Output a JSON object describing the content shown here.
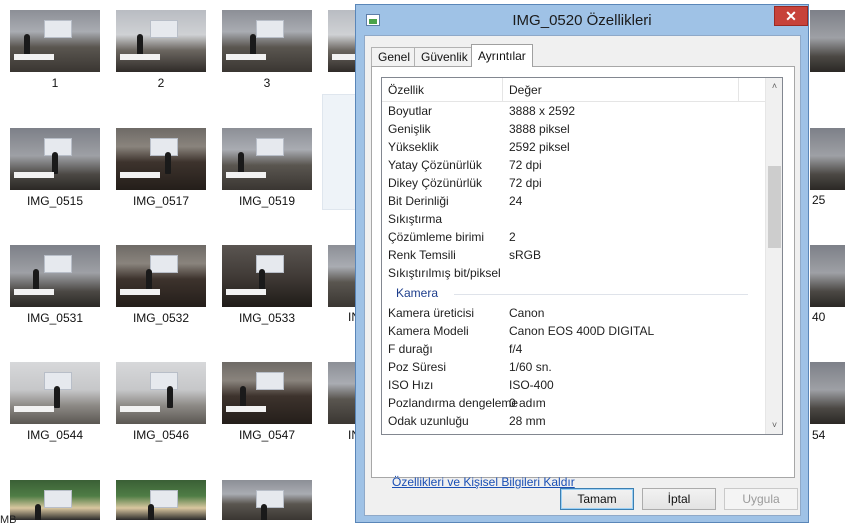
{
  "explorer": {
    "thumbnails": [
      {
        "label": "1",
        "scene": "hall"
      },
      {
        "label": "2",
        "scene": "hall2"
      },
      {
        "label": "3",
        "scene": "hall"
      },
      {
        "label": "",
        "scene": "hall2"
      },
      {
        "label": "IMG_0515",
        "scene": "side"
      },
      {
        "label": "IMG_0517",
        "scene": "crowd"
      },
      {
        "label": "IMG_0519",
        "scene": "hall"
      },
      {
        "label": "IMG_0531",
        "scene": "side"
      },
      {
        "label": "IMG_0532",
        "scene": "crowd"
      },
      {
        "label": "IMG_0533",
        "scene": "dark"
      },
      {
        "label": "IMG_0544",
        "scene": "light"
      },
      {
        "label": "IMG_0546",
        "scene": "light"
      },
      {
        "label": "IMG_0547",
        "scene": "crowd"
      },
      {
        "label": "",
        "scene": "green"
      },
      {
        "label": "",
        "scene": "green"
      },
      {
        "label": "",
        "scene": "hall"
      }
    ],
    "partial_labels": {
      "r2": "IN",
      "r3": "IN",
      "r4": "IN",
      "right_r2": "25",
      "right_r3": "40",
      "right_r4": "54"
    },
    "status_text": "MB"
  },
  "dialog": {
    "title": "IMG_0520 Özellikleri",
    "close_glyph": "✕",
    "tabs": [
      {
        "label": "Genel",
        "active": false
      },
      {
        "label": "Güvenlik",
        "active": false
      },
      {
        "label": "Ayrıntılar",
        "active": true
      }
    ],
    "columns": {
      "property": "Özellik",
      "value": "Değer"
    },
    "rows": [
      {
        "k": "Boyutlar",
        "v": "3888 x 2592"
      },
      {
        "k": "Genişlik",
        "v": "3888 piksel"
      },
      {
        "k": "Yükseklik",
        "v": "2592 piksel"
      },
      {
        "k": "Yatay Çözünürlük",
        "v": "72 dpi"
      },
      {
        "k": "Dikey Çözünürlük",
        "v": "72 dpi"
      },
      {
        "k": "Bit Derinliği",
        "v": "24"
      },
      {
        "k": "Sıkıştırma",
        "v": ""
      },
      {
        "k": "Çözümleme birimi",
        "v": "2"
      },
      {
        "k": "Renk Temsili",
        "v": "sRGB"
      },
      {
        "k": "Sıkıştırılmış bit/piksel",
        "v": ""
      }
    ],
    "group_camera": "Kamera",
    "camera_rows": [
      {
        "k": "Kamera üreticisi",
        "v": "Canon"
      },
      {
        "k": "Kamera Modeli",
        "v": "Canon EOS 400D DIGITAL"
      },
      {
        "k": "F durağı",
        "v": "f/4"
      },
      {
        "k": "Poz Süresi",
        "v": "1/60 sn."
      },
      {
        "k": "ISO Hızı",
        "v": "ISO-400"
      },
      {
        "k": "Pozlandırma dengeleme",
        "v": "0 adım"
      },
      {
        "k": "Odak uzunluğu",
        "v": "28 mm"
      }
    ],
    "scroll": {
      "up_glyph": "˄",
      "down_glyph": "˅"
    },
    "remove_link": "Özellikleri ve Kişisel Bilgileri Kaldır",
    "buttons": {
      "ok": "Tamam",
      "cancel": "İptal",
      "apply": "Uygula"
    }
  }
}
